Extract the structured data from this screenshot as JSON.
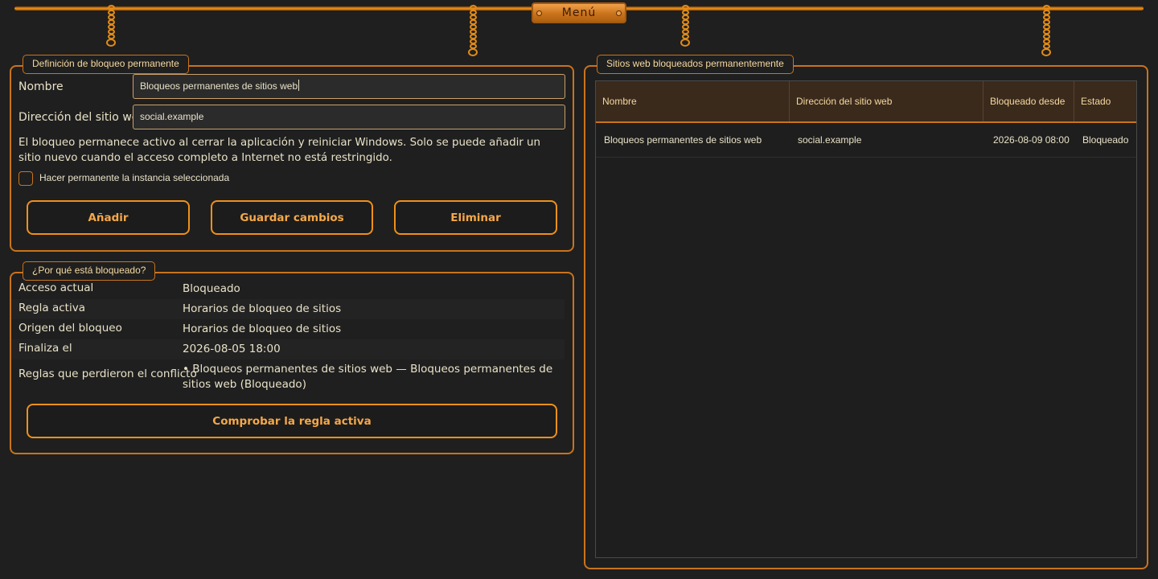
{
  "menu": {
    "label": "Menú"
  },
  "definition": {
    "title": "Definición de bloqueo permanente",
    "name_label": "Nombre",
    "name_value": "Bloqueos permanentes de sitios web",
    "address_label": "Dirección del sitio web",
    "address_value": "social.example",
    "info": "El bloqueo permanece activo al cerrar la aplicación y reiniciar Windows. Solo se puede añadir un sitio nuevo cuando el acceso completo a Internet no está restringido.",
    "checkbox_label": "Hacer permanente la instancia seleccionada",
    "checkbox_checked": false,
    "add_label": "Añadir",
    "save_label": "Guardar cambios",
    "delete_label": "Eliminar"
  },
  "why": {
    "title": "¿Por qué está bloqueado?",
    "rows": [
      {
        "label": "Acceso actual",
        "value": "Bloqueado"
      },
      {
        "label": "Regla activa",
        "value": "Horarios de bloqueo de sitios"
      },
      {
        "label": "Origen del bloqueo",
        "value": "Horarios de bloqueo de sitios"
      },
      {
        "label": "Finaliza el",
        "value": "2026-08-05 18:00"
      },
      {
        "label": "Reglas que perdieron el conflicto",
        "value": "• Bloqueos permanentes de sitios web — Bloqueos permanentes de sitios web (Bloqueado)"
      }
    ],
    "check_label": "Comprobar la regla activa"
  },
  "sites": {
    "title": "Sitios web bloqueados permanentemente",
    "columns": [
      "Nombre",
      "Dirección del sitio web",
      "Bloqueado desde",
      "Estado"
    ],
    "rows": [
      [
        "Bloqueos permanentes de sitios web",
        "social.example",
        "2026-08-09 08:00",
        "Bloqueado"
      ]
    ]
  },
  "colors": {
    "accent": "#f0901a",
    "accent_dark": "#c9731c",
    "background": "#1f1f1f",
    "text": "#e9e2c8",
    "header_bg": "#3a2a1c"
  }
}
